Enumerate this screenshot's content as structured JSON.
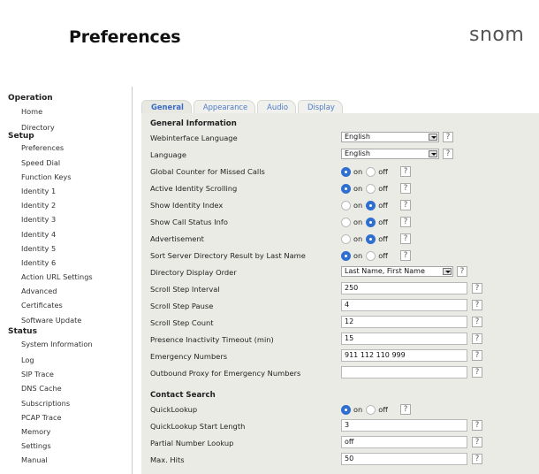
{
  "header": {
    "title": "Preferences",
    "brand": "snom"
  },
  "sidebar": {
    "groups": [
      {
        "title": "Operation",
        "items": [
          "Home",
          "Directory"
        ]
      },
      {
        "title": "Setup",
        "items": [
          "Preferences",
          "Speed Dial",
          "Function Keys",
          "Identity 1",
          "Identity 2",
          "Identity 3",
          "Identity 4",
          "Identity 5",
          "Identity 6",
          "Action URL Settings",
          "Advanced",
          "Certificates",
          "Software Update"
        ]
      },
      {
        "title": "Status",
        "items": [
          "System Information",
          "Log",
          "SIP Trace",
          "DNS Cache",
          "Subscriptions",
          "PCAP Trace",
          "Memory",
          "Settings",
          "Manual"
        ]
      }
    ]
  },
  "tabs": [
    {
      "label": "General",
      "active": true
    },
    {
      "label": "Appearance",
      "active": false
    },
    {
      "label": "Audio",
      "active": false
    },
    {
      "label": "Display",
      "active": false
    }
  ],
  "toggle_labels": {
    "on": "on",
    "off": "off"
  },
  "help_label": "?",
  "sections": {
    "general_information": "General Information",
    "contact_search": "Contact Search"
  },
  "settings": {
    "webinterface_language": {
      "label": "Webinterface Language",
      "value": "English"
    },
    "language": {
      "label": "Language",
      "value": "English"
    },
    "global_counter": {
      "label": "Global Counter for Missed Calls",
      "state": "on"
    },
    "active_identity_scrolling": {
      "label": "Active Identity Scrolling",
      "state": "on"
    },
    "show_identity_index": {
      "label": "Show Identity Index",
      "state": "off"
    },
    "show_call_status_info": {
      "label": "Show Call Status Info",
      "state": "off"
    },
    "advertisement": {
      "label": "Advertisement",
      "state": "off"
    },
    "sort_server_directory": {
      "label": "Sort Server Directory Result by Last Name",
      "state": "on"
    },
    "directory_display_order": {
      "label": "Directory Display Order",
      "value": "Last Name, First Name"
    },
    "scroll_step_interval": {
      "label": "Scroll Step Interval",
      "value": "250"
    },
    "scroll_step_pause": {
      "label": "Scroll Step Pause",
      "value": "4"
    },
    "scroll_step_count": {
      "label": "Scroll Step Count",
      "value": "12"
    },
    "presence_inactivity_timeout": {
      "label": "Presence Inactivity Timeout (min)",
      "value": "15"
    },
    "emergency_numbers": {
      "label": "Emergency Numbers",
      "value": "911 112 110 999"
    },
    "outbound_proxy_emergency": {
      "label": "Outbound Proxy for Emergency Numbers",
      "value": ""
    },
    "quicklookup": {
      "label": "QuickLookup",
      "state": "on"
    },
    "quicklookup_start_length": {
      "label": "QuickLookup Start Length",
      "value": "3"
    },
    "partial_number_lookup": {
      "label": "Partial Number Lookup",
      "value": "off"
    },
    "max_hits": {
      "label": "Max. Hits",
      "value": "50"
    }
  },
  "colors": {
    "panel": "#ebebe6",
    "accent": "#2f6fd0",
    "tab_text": "#4e7ac7"
  }
}
